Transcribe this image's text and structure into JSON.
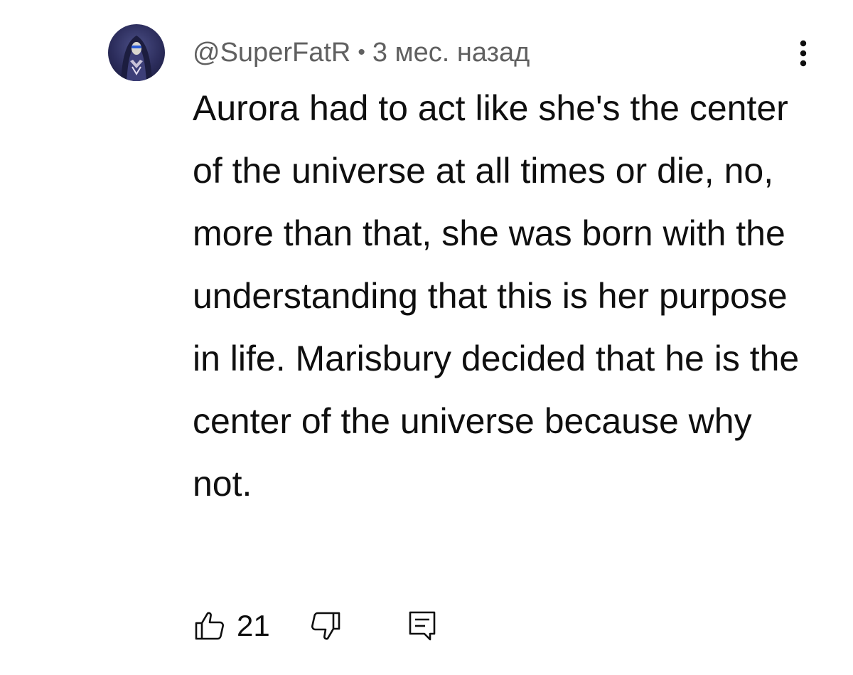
{
  "comment": {
    "author": "@SuperFatR",
    "separator": "•",
    "timestamp": "3 мес. назад",
    "text": "Aurora had to act like she's the center of the universe at all times or die, no, more than that, she was born with the understanding that this is her purpose in life. Marisbury decided that he is the center of the universe because why not.",
    "like_count": "21"
  },
  "icons": {
    "avatar": "avatar-image",
    "more": "kebab-menu-icon",
    "like": "thumbs-up-icon",
    "dislike": "thumbs-down-icon",
    "reply": "reply-comment-icon"
  },
  "colors": {
    "text": "#0f0f0f",
    "meta": "#606060",
    "background": "#ffffff"
  }
}
